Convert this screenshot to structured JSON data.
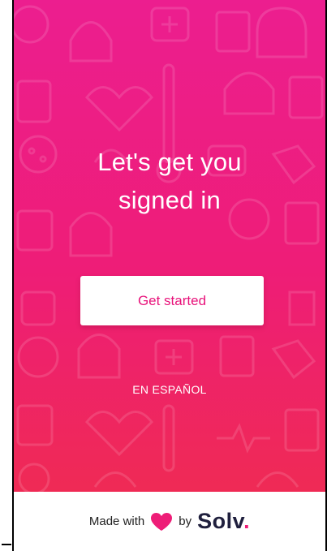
{
  "hero": {
    "headline_line1": "Let's get you",
    "headline_line2": "signed in",
    "cta_label": "Get started",
    "language_link": "EN ESPAÑOL"
  },
  "footer": {
    "prefix": "Made with",
    "heart_icon": "heart-icon",
    "suffix": "by",
    "brand": "Solv",
    "brand_dot": "."
  },
  "colors": {
    "background_top": "#ec1e8f",
    "background_bottom": "#ef2a55",
    "accent": "#e8127a",
    "heart": "#ee1d77",
    "brand_text": "#1f1f3d"
  }
}
